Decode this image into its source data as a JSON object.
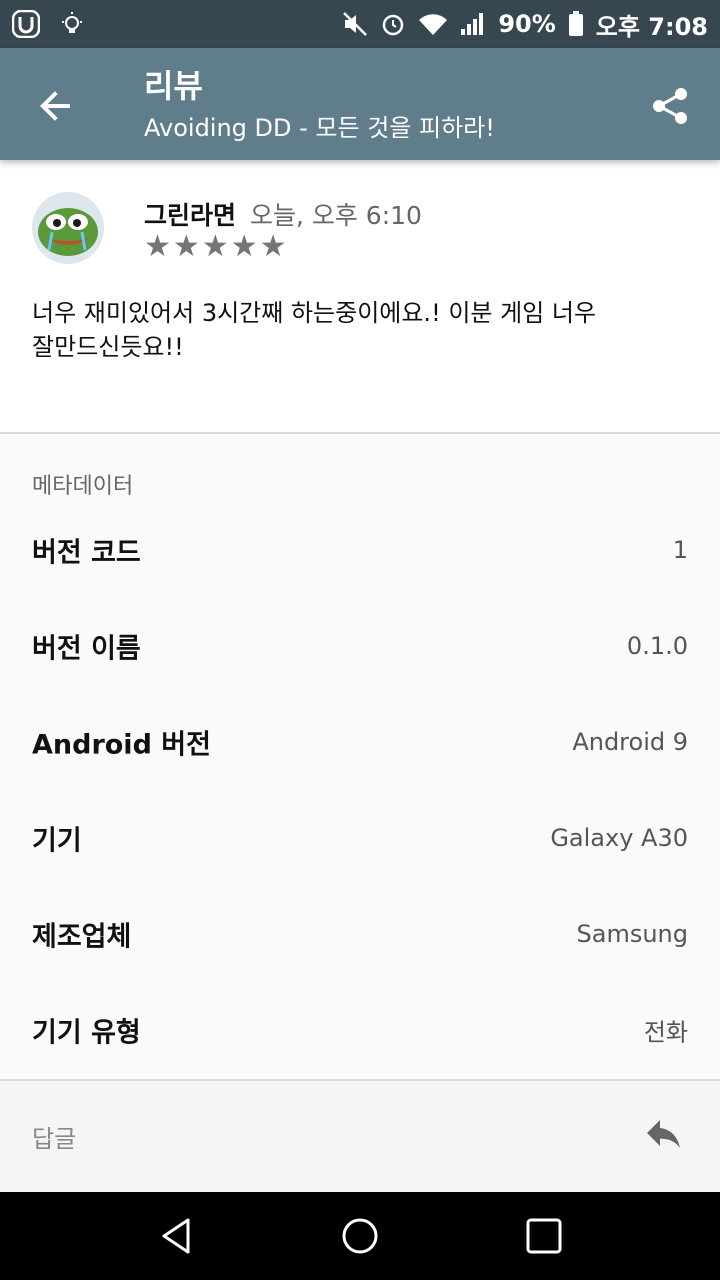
{
  "status_bar": {
    "battery": "90%",
    "time": "오후 7:08"
  },
  "app_bar": {
    "title": "리뷰",
    "subtitle": "Avoiding DD - 모든 것을 피하라!"
  },
  "review": {
    "author": "그린라면",
    "date": "오늘, 오후 6:10",
    "rating": 5,
    "stars": [
      "★",
      "★",
      "★",
      "★",
      "★"
    ],
    "text_line1": "너우 재미있어서 3시간째 하는중이에요.! 이분 게임 너우",
    "text_line2": "잘만드신듯요!!"
  },
  "metadata": {
    "header": "메타데이터",
    "rows": [
      {
        "label": "버전 코드",
        "value": "1"
      },
      {
        "label": "버전 이름",
        "value": "0.1.0"
      },
      {
        "label": "Android 버전",
        "value": "Android 9"
      },
      {
        "label": "기기",
        "value": "Galaxy A30"
      },
      {
        "label": "제조업체",
        "value": "Samsung"
      },
      {
        "label": "기기 유형",
        "value": "전화"
      }
    ]
  },
  "reply": {
    "label": "답글"
  },
  "icons": {
    "back": "arrow-back-icon",
    "share": "share-icon",
    "reply": "reply-icon"
  },
  "colors": {
    "status_bar": "#37474f",
    "app_bar": "#607d8b",
    "star": "#757575"
  }
}
